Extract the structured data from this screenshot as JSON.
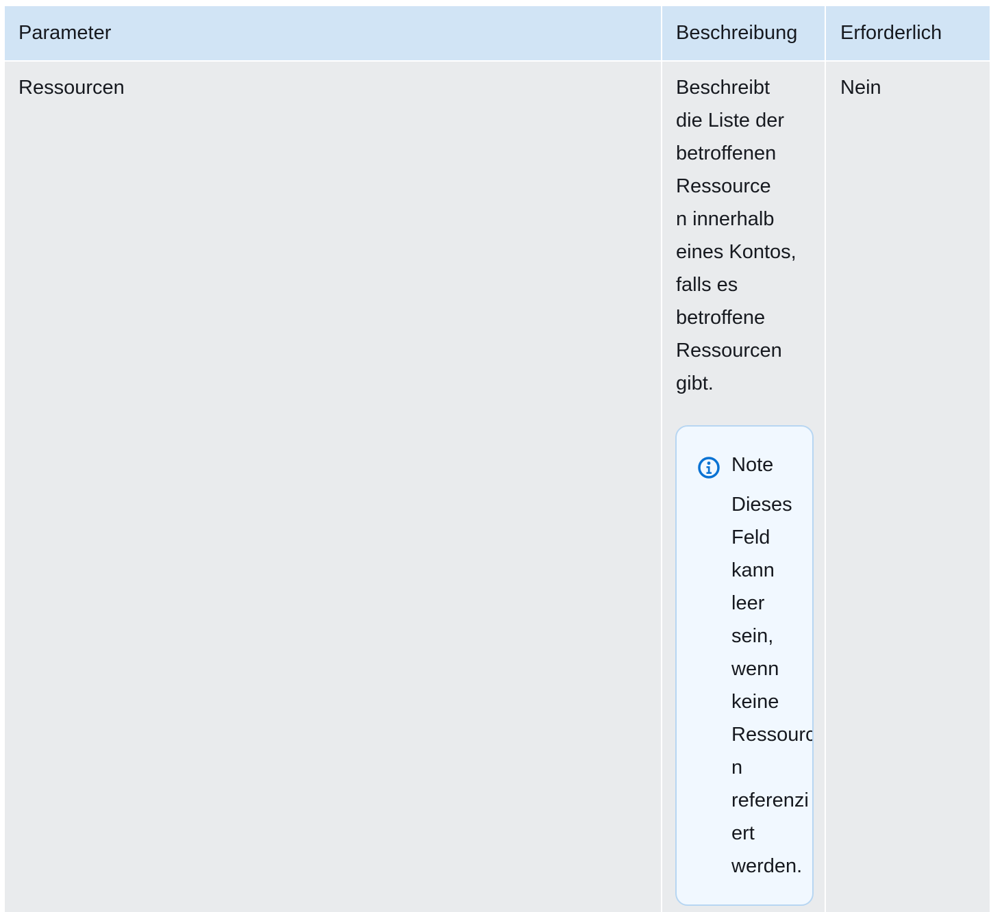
{
  "table": {
    "headers": {
      "parameter": "Parameter",
      "description": "Beschreibung",
      "required": "Erforderlich"
    },
    "rows": [
      {
        "parameter": "Ressourcen",
        "description": "Beschreibt\ndie Liste der\nbetroffenen\nRessource\nn innerhalb\neines Kontos,\nfalls es\nbetroffene\nRessourcen\ngibt.",
        "required": "Nein",
        "note": {
          "icon": "info-icon",
          "title": "Note",
          "body": "Dieses\nFeld\nkann\nleer\nsein,\nwenn\nkeine\nRessource\nn\nreferenzi\nert\nwerden."
        }
      }
    ]
  },
  "colors": {
    "header_bg": "#d1e4f5",
    "row_bg": "#e9ebed",
    "note_bg": "#f1f8ff",
    "note_border": "#b7d6f2",
    "info_icon": "#0972d3"
  }
}
